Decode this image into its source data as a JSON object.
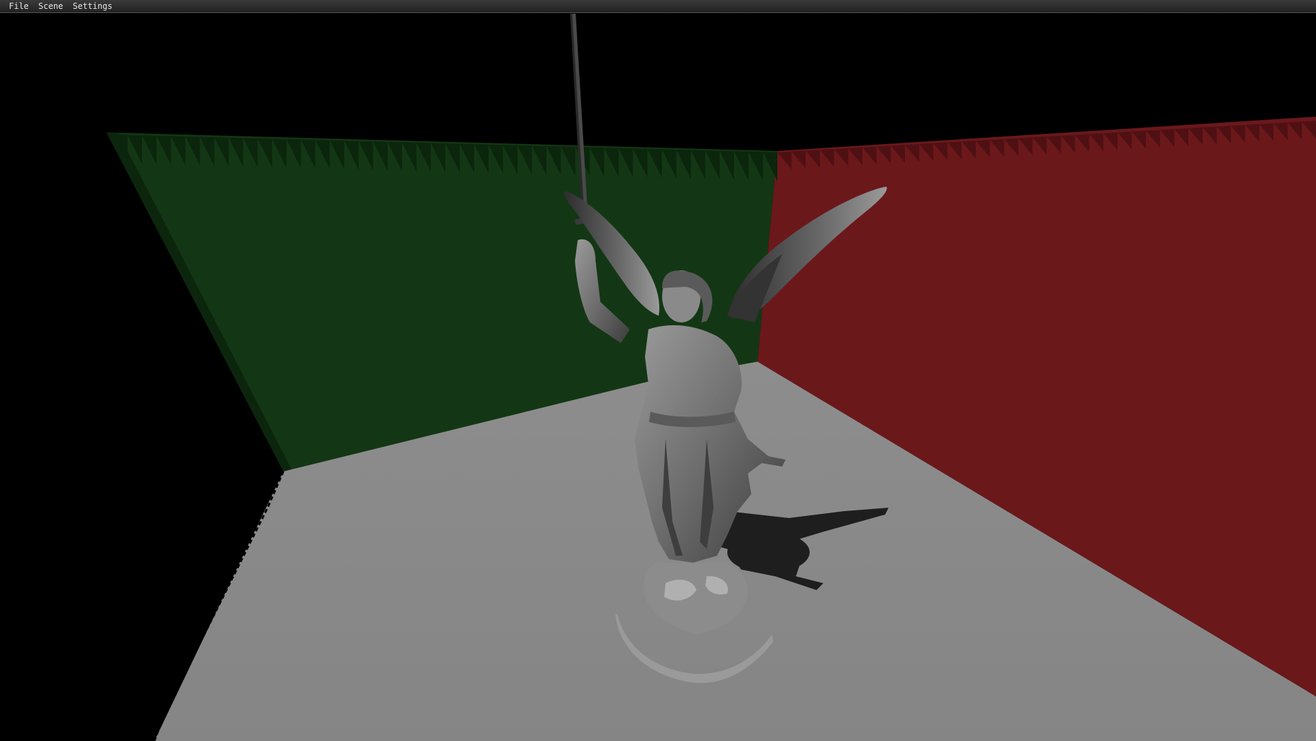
{
  "menu": {
    "items": [
      {
        "label": "File"
      },
      {
        "label": "Scene"
      },
      {
        "label": "Settings"
      }
    ]
  },
  "scene": {
    "colors": {
      "background": "#000000",
      "left_wall": "#133714",
      "right_wall": "#6b181b",
      "floor": "#8a8a8a",
      "statue": "#7d7d7d",
      "shadow": "#1e1e1e"
    }
  }
}
